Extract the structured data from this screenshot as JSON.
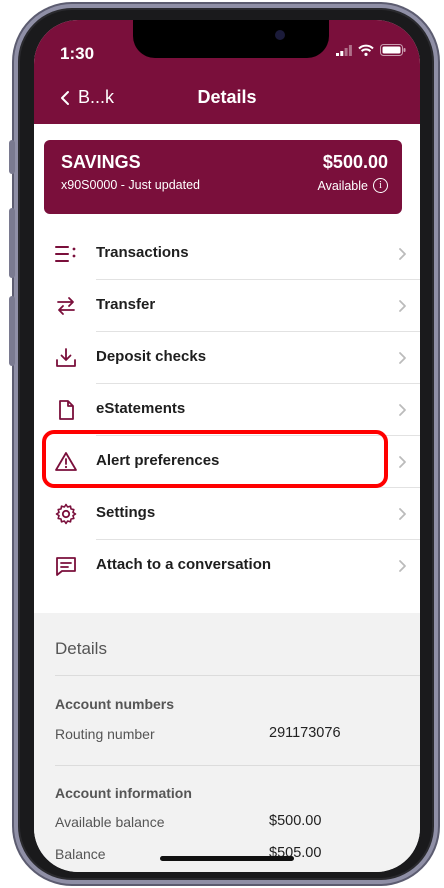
{
  "status_bar": {
    "time": "1:30"
  },
  "nav": {
    "back_label": "B...k",
    "title": "Details"
  },
  "account_card": {
    "name": "SAVINGS",
    "subtitle": "x90S0000 - Just updated",
    "amount": "$500.00",
    "available_label": "Available"
  },
  "menu": [
    {
      "label": "Transactions",
      "icon": "list-icon"
    },
    {
      "label": "Transfer",
      "icon": "transfer-arrows-icon"
    },
    {
      "label": "Deposit checks",
      "icon": "download-tray-icon"
    },
    {
      "label": "eStatements",
      "icon": "document-icon"
    },
    {
      "label": "Alert preferences",
      "icon": "warning-triangle-icon"
    },
    {
      "label": "Settings",
      "icon": "gear-icon"
    },
    {
      "label": "Attach to a conversation",
      "icon": "chat-bubble-icon"
    }
  ],
  "details": {
    "title": "Details",
    "account_numbers": {
      "heading": "Account numbers",
      "routing_label": "Routing number",
      "routing_value": "291173076"
    },
    "account_information": {
      "heading": "Account information",
      "rows": [
        {
          "label": "Available balance",
          "value": "$500.00"
        },
        {
          "label": "Balance",
          "value": "$505.00"
        }
      ]
    }
  },
  "colors": {
    "brand": "#7a0f3b",
    "highlight": "#ff0000"
  }
}
